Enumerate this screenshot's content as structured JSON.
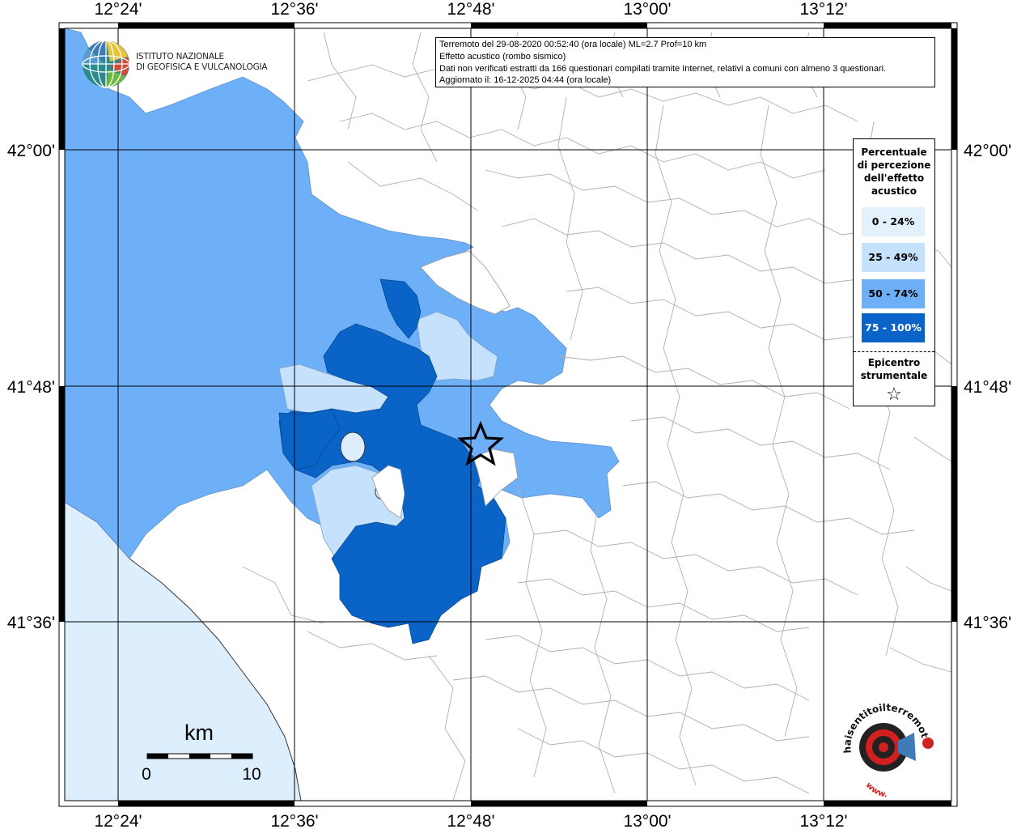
{
  "map": {
    "lon_ticks": [
      "12°24'",
      "12°36'",
      "12°48'",
      "13°00'",
      "13°12'"
    ],
    "lat_ticks": [
      "42°00'",
      "41°48'",
      "41°36'"
    ],
    "colors": {
      "sea": "#ddeefc",
      "land": "#ffffff",
      "class_0_24": "#e3f1fd",
      "class_25_49": "#c6e1fb",
      "class_50_74": "#6eb0f8",
      "class_75_100": "#0a64c8",
      "boundaries": "#aaaaaa",
      "grid": "#000000"
    }
  },
  "info": {
    "line1": "Terremoto del 29-08-2020 00:52:40 (ora locale) ML=2.7 Prof=10 km",
    "line2": "Effetto acustico (rombo sismico)",
    "line3": "Dati non verificati estratti da 166 questionari compilati tramite Internet, relativi a comuni con almeno 3 questionari.",
    "line4": "Aggiornato il: 16-12-2025 04:44 (ora locale)"
  },
  "legend": {
    "title_lines": [
      "Percentuale",
      "di percezione",
      "dell'effetto",
      "acustico"
    ],
    "items": [
      {
        "label": "0 - 24%",
        "color": "#e3f1fd",
        "text_color": "#000000"
      },
      {
        "label": "25 - 49%",
        "color": "#c6e1fb",
        "text_color": "#000000"
      },
      {
        "label": "50 - 74%",
        "color": "#6eb0f8",
        "text_color": "#000000"
      },
      {
        "label": "75 - 100%",
        "color": "#0a64c8",
        "text_color": "#ffffff"
      }
    ],
    "epicenter_lines": [
      "Epicentro",
      "strumentale"
    ],
    "epicenter_symbol": "☆"
  },
  "scalebar": {
    "unit": "km",
    "start": "0",
    "end": "10"
  },
  "logos": {
    "ingv_line1": "ISTITUTO NAZIONALE",
    "ingv_line2": "DI GEOFISICA E VULCANOLOGIA",
    "hst_top": "haisentitoilterremoto.it",
    "hst_bottom": "www."
  }
}
